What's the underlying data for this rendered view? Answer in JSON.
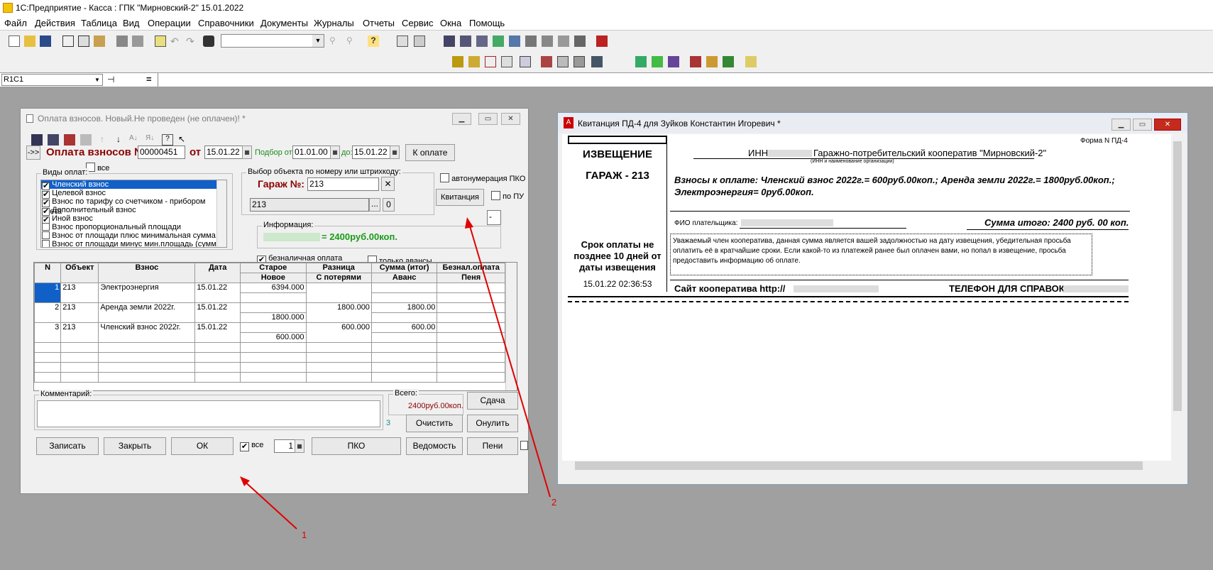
{
  "app": {
    "title": "1С:Предприятие - Касса : ГПК \"Мирновский-2\" 15.01.2022"
  },
  "menu": [
    "Файл",
    "Действия",
    "Таблица",
    "Вид",
    "Операции",
    "Справочники",
    "Документы",
    "Журналы",
    "Отчеты",
    "Сервис",
    "Окна",
    "Помощь"
  ],
  "formula_bar": {
    "cell": "R1C1"
  },
  "payment": {
    "title": "Оплата взносов. Новый.Не проведен (не оплачен)! *",
    "doc_label": "Оплата взносов №",
    "doc_number": "00000451",
    "from_label": "от",
    "date": "15.01.22",
    "sel_from_label": "Подбор от:",
    "sel_from": "01.01.00",
    "sel_to_label": "до:",
    "sel_to": "15.01.22",
    "to_pay_button": "К оплате",
    "all_label": "все",
    "types_label": "Виды оплат:",
    "types": [
      {
        "label": "Членский взнос",
        "checked": true,
        "selected": true
      },
      {
        "label": "Целевой взнос",
        "checked": true
      },
      {
        "label": "Взнос по тарифу со счетчиком - прибором учета",
        "checked": true
      },
      {
        "label": "Дополнительный взнос",
        "checked": true
      },
      {
        "label": "Иной взнос",
        "checked": true
      },
      {
        "label": "Взнос пропорциональный площади",
        "checked": false
      },
      {
        "label": "Взнос от площади плюс минимальная сумма",
        "checked": false
      },
      {
        "label": "Взнос от площади минус мин.площадь (сумма)",
        "checked": false
      }
    ],
    "select_group": "Выбор объекта по номеру или штрихкоду:",
    "garage_label": "Гараж №:",
    "garage_value": "213",
    "garage_value2": "213",
    "zero": "0",
    "dots": "...",
    "autonum_label": "автонумерация ПКО",
    "receipt_button": "Квитанция",
    "by_pu_label": "по ПУ",
    "dash": "-",
    "info_label": "Информация:",
    "info_text": "= 2400руб.00коп.",
    "cashless_label": "безналичная оплата",
    "adv_only_label": "только авансы",
    "table": {
      "h1": [
        "N",
        "Объект",
        "Взнос",
        "Дата",
        "Старое",
        "Разница",
        "Сумма (итог)",
        "Безнал.оплата"
      ],
      "h2": [
        "Новое",
        "С потерями",
        "Аванс",
        "Пеня"
      ],
      "rows": [
        {
          "n": "1",
          "obj": "213",
          "fee": "Электроэнергия",
          "date": "15.01.22",
          "old": "6394.000",
          "new": "",
          "diff": "",
          "sum": "",
          "adv": ""
        },
        {
          "n": "2",
          "obj": "213",
          "fee": "Аренда земли 2022г.",
          "date": "15.01.22",
          "old": "",
          "new": "1800.000",
          "diff": "1800.000",
          "sum": "1800.00",
          "adv": ""
        },
        {
          "n": "3",
          "obj": "213",
          "fee": "Членский взнос 2022г.",
          "date": "15.01.22",
          "old": "",
          "new": "600.000",
          "diff": "600.000",
          "sum": "600.00",
          "adv": ""
        }
      ]
    },
    "comment_label": "Комментарий:",
    "total_label": "Всего:",
    "total_value": "2400руб.00коп.",
    "counter": "3",
    "buttons": {
      "change": "Сдача",
      "clear": "Очистить",
      "zero": "Онулить",
      "write": "Записать",
      "close": "Закрыть",
      "ok": "ОК",
      "pko": "ПКО",
      "statement": "Ведомость",
      "fines": "Пени"
    },
    "copies": "1",
    "all2_label": "все"
  },
  "receipt": {
    "title": "Квитанция ПД-4  для Зуйков Константин Игоревич  *",
    "notice": "ИЗВЕЩЕНИЕ",
    "garage": "ГАРАЖ - 213",
    "deadline": "Срок оплаты не позднее 10 дней от даты извещения",
    "datetime": "15.01.22 02:36:53",
    "form": "Форма N ПД-4",
    "inn_label": "ИНН",
    "coop": "Гаражно-потребительский кооператив \"Мирновский-2\"",
    "inn_caption": "(ИНН и наименование организации)",
    "fees": "Взносы к оплате: Членский взнос 2022г.= 600руб.00коп.; Аренда земли 2022г.= 1800руб.00коп.; Электроэнергия= 0руб.00коп.",
    "payer_label": "ФИО плательщика:",
    "total": "Сумма итого:  2400 руб. 00 коп.",
    "note": "Уважаемый член кооператива, данная сумма является вашей задолжностью на дату извещения, убедительная просьба оплатить её в кратчайшие сроки. Если какой-то из платежей ранее был оплачен вами, но попал в извещение, просьба предоставить информацию об оплате.",
    "site": "Сайт кооператива http://",
    "phone": "ТЕЛЕФОН ДЛЯ СПРАВОК"
  },
  "annotations": [
    "1",
    "2"
  ],
  "colors": {
    "accent_red": "#e00000",
    "doc_title": "#8b0000",
    "info_green": "#1a9b1a"
  }
}
